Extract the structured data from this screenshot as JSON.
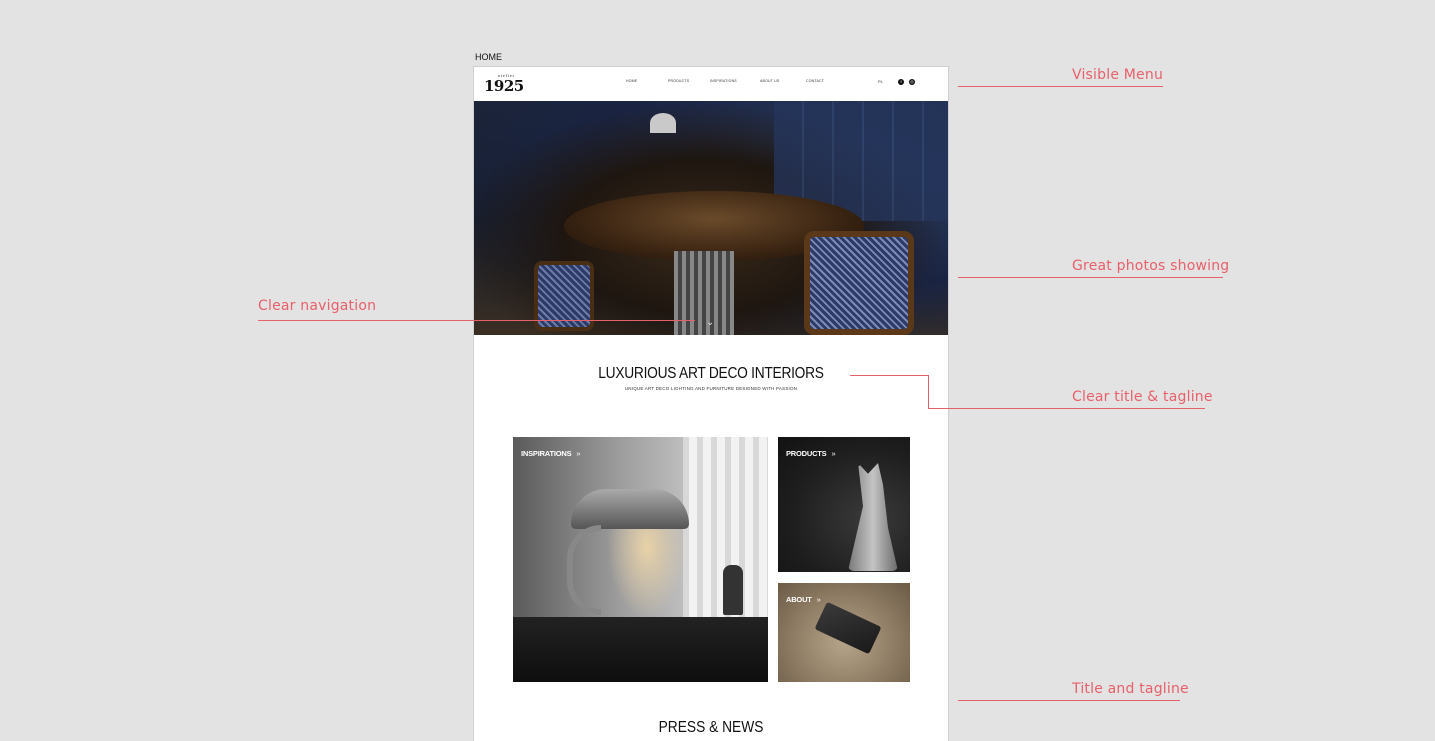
{
  "page_label": "HOME",
  "site": {
    "logo": {
      "small": "atelier",
      "main": "1925"
    },
    "menu": [
      "HOME",
      "PRODUCTS",
      "INSPIRATIONS",
      "ABOUT US",
      "CONTACT"
    ],
    "lang": "PL",
    "social": [
      "facebook-icon",
      "instagram-icon"
    ],
    "hero_scroll_icon": "chevron-down-icon",
    "title": "LUXURIOUS ART DECO INTERIORS",
    "tagline": "UNIQUE ART DECO LIGHTING AND FURNITURE DESIGNED WITH PASSION",
    "tiles": [
      {
        "label": "INSPIRATIONS",
        "arrow": "»"
      },
      {
        "label": "PRODUCTS",
        "arrow": "»"
      },
      {
        "label": "ABOUT",
        "arrow": "»"
      }
    ],
    "press_title": "PRESS & NEWS"
  },
  "annotations": {
    "visible_menu": "Visible Menu",
    "great_photos": "Great photos showing",
    "clear_navigation": "Clear navigation",
    "clear_title": "Clear title & tagline",
    "title_tagline": "Title and tagline"
  },
  "colors": {
    "annotation": "#e8606a",
    "background": "#e3e3e3"
  }
}
